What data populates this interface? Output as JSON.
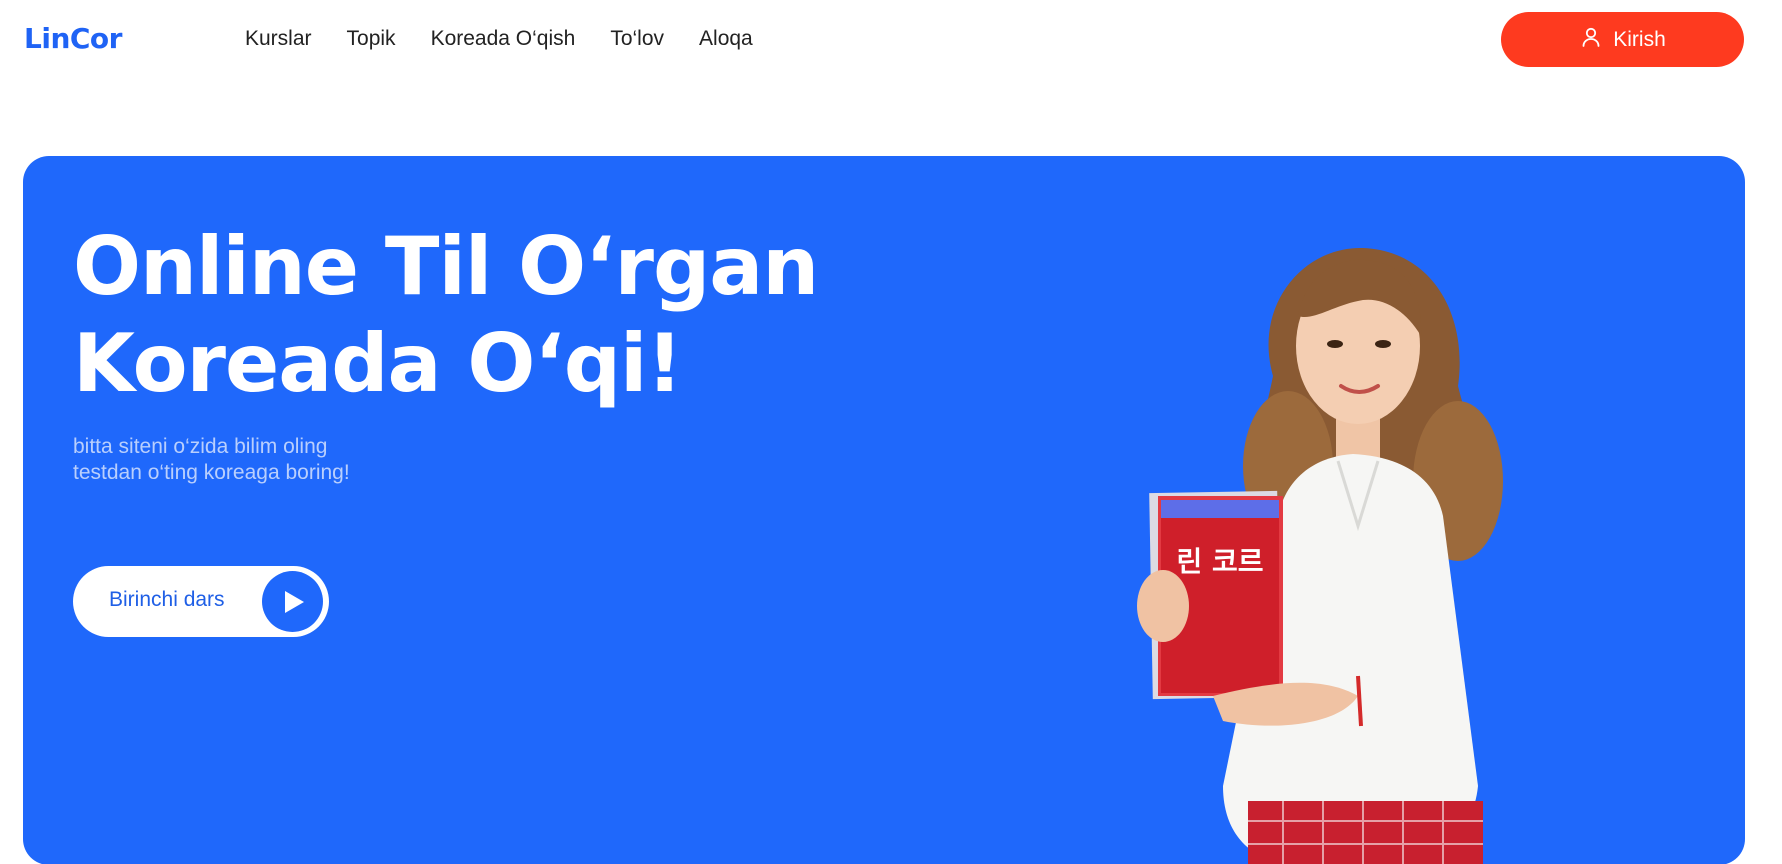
{
  "header": {
    "logo": "LinCor",
    "nav": [
      "Kurslar",
      "Topik",
      "Koreada O‘qish",
      "To‘lov",
      "Aloqa"
    ],
    "login_label": "Kirish",
    "login_icon": "user-icon"
  },
  "hero": {
    "title_line1": "Online Til O‘rgan",
    "title_line2": "Koreada O‘qi!",
    "subtitle_line1": "bitta siteni o‘zida bilim oling",
    "subtitle_line2": "testdan o‘ting koreaga boring!",
    "cta_label": "Birinchi dars",
    "cta_icon": "play-icon",
    "book_text": "린 코르"
  },
  "colors": {
    "brand_blue": "#1f68fb",
    "accent_red": "#fe3a1f",
    "white": "#ffffff"
  }
}
